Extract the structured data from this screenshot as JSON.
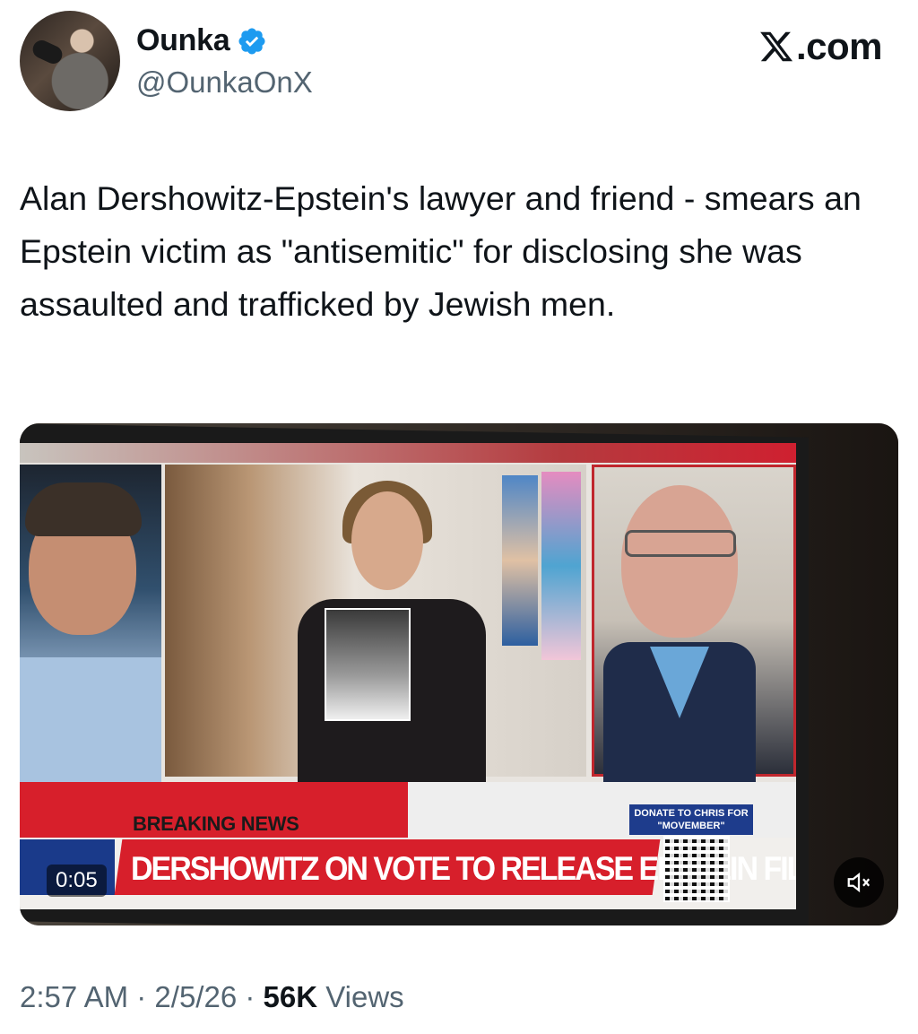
{
  "author": {
    "display_name": "Ounka",
    "handle": "@OunkaOnX",
    "verified_icon": "verified-badge-icon",
    "avatar_icon": "user-avatar"
  },
  "brand": {
    "site_label": ".com",
    "logo_icon": "x-logo-icon"
  },
  "tweet": {
    "text": "Alan Dershowitz-Epstein's lawyer and friend - smears an Epstein victim as \"antisemitic\" for disclosing she was assaulted and trafficked by Jewish men."
  },
  "video": {
    "breaking_label": "BREAKING NEWS",
    "headline": "DERSHOWITZ ON VOTE TO RELEASE EPSTEIN FILES",
    "donate_line1": "DONATE TO CHRIS FOR",
    "donate_line2": "\"MOVEMBER\"",
    "elapsed": "0:05",
    "mute_icon": "speaker-muted-icon"
  },
  "meta": {
    "time": "2:57 AM",
    "separator": "·",
    "date": "2/5/26",
    "views_count": "56K",
    "views_label": "Views"
  },
  "colors": {
    "verified_blue": "#1d9bf0",
    "news_red": "#d71f2b",
    "secondary_text": "#536471"
  }
}
